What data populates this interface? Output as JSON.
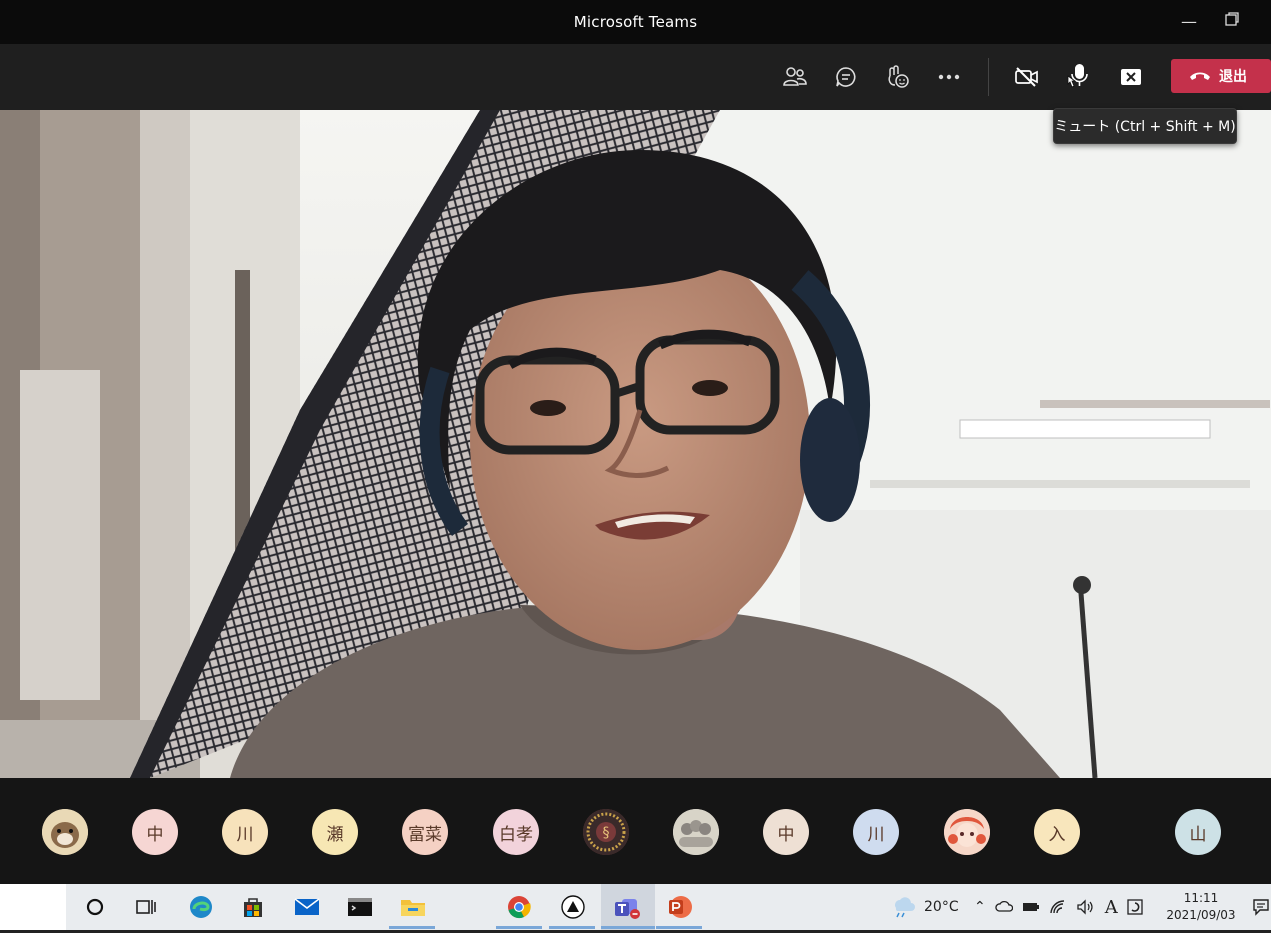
{
  "window": {
    "title": "Microsoft Teams"
  },
  "toolbar": {
    "buttons": [
      {
        "name": "participants-icon"
      },
      {
        "name": "chat-icon"
      },
      {
        "name": "reactions-icon"
      },
      {
        "name": "more-options-icon"
      },
      {
        "name": "camera-off-icon"
      },
      {
        "name": "microphone-icon"
      },
      {
        "name": "share-screen-icon"
      }
    ],
    "leave_label": "退出",
    "tooltip": "ミュート (Ctrl + Shift + M)"
  },
  "participants": [
    {
      "initial": "",
      "bg": "#e9d9b6",
      "kind": "photo-otter"
    },
    {
      "initial": "中",
      "bg": "#f6d6d3"
    },
    {
      "initial": "川",
      "bg": "#f7e2bb"
    },
    {
      "initial": "瀬",
      "bg": "#f7e7b4"
    },
    {
      "initial": "富菜",
      "bg": "#f5d1c4"
    },
    {
      "initial": "白孝",
      "bg": "#f2d3db"
    },
    {
      "initial": "",
      "bg": "#6b3b3b",
      "kind": "photo-pattern"
    },
    {
      "initial": "",
      "bg": "#d8d4c8",
      "kind": "photo-group"
    },
    {
      "initial": "中",
      "bg": "#eee0d4"
    },
    {
      "initial": "川",
      "bg": "#cfdcef"
    },
    {
      "initial": "",
      "bg": "#f2c4b8",
      "kind": "photo-anime"
    },
    {
      "initial": "入",
      "bg": "#f8e6bc"
    },
    {
      "initial": "山",
      "bg": "#cde1e6"
    }
  ],
  "taskbar": {
    "weather": "20°C",
    "time": "11:11",
    "date": "2021/09/03",
    "ime": "A"
  },
  "colors": {
    "leave": "#c4314b",
    "toolbar": "#1f1f1f",
    "titlebar": "#0b0b0b"
  }
}
